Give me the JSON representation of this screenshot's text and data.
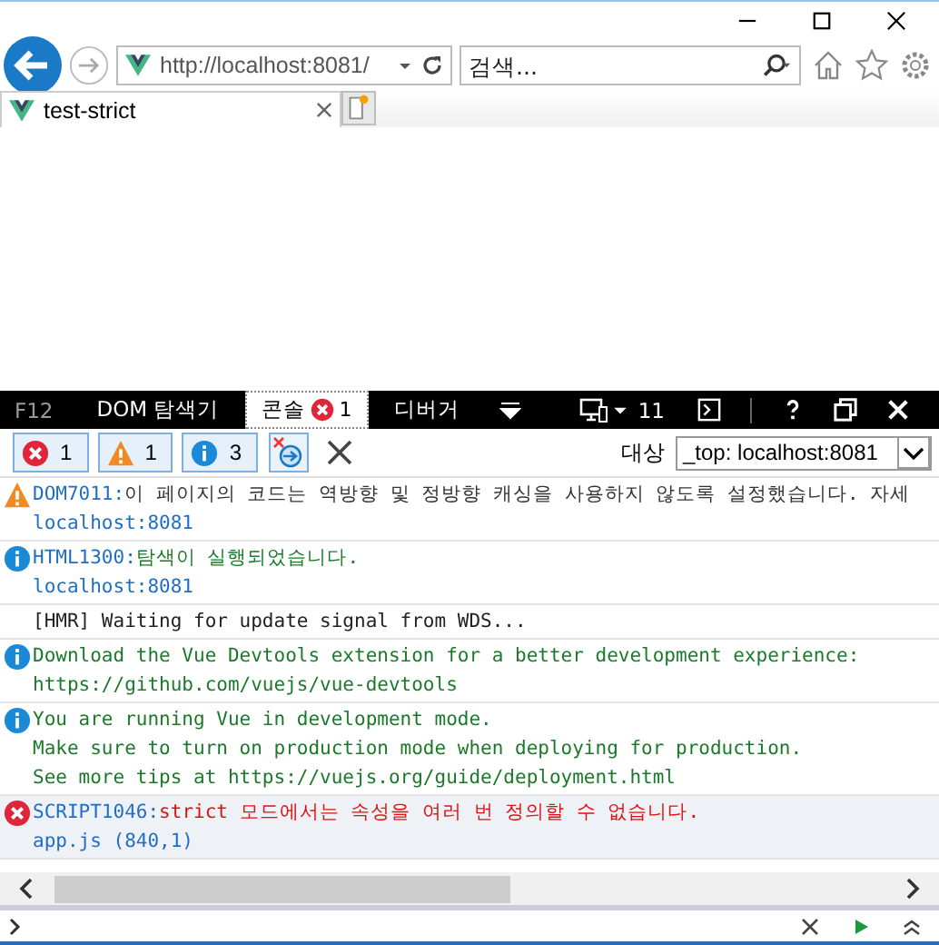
{
  "browser": {
    "address": "http://localhost:8081/",
    "search": {
      "placeholder": "검색..."
    },
    "tabs": [
      {
        "label": "test-strict",
        "selected": true
      }
    ]
  },
  "devtools": {
    "label": "F12",
    "tabs": [
      {
        "label": "DOM 탐색기",
        "selected": false
      },
      {
        "label": "콘솔",
        "selected": true,
        "errors": "1"
      },
      {
        "label": "디버거",
        "selected": false
      }
    ],
    "emulation": "11",
    "filters": [
      {
        "kind": "error",
        "count": "1",
        "on": true
      },
      {
        "kind": "warning",
        "count": "1",
        "on": true
      },
      {
        "kind": "info",
        "count": "3",
        "on": true
      }
    ],
    "target_label": "대상",
    "target": "_top: localhost:8081",
    "messages": [
      {
        "kind": "warning",
        "code": "DOM7011:",
        "lines": [
          "이 페이지의 코드는 역방향 및 정방향 캐싱을 사용하지 않도록 설정했습니다. 자세"
        ],
        "source": "localhost:8081"
      },
      {
        "kind": "info",
        "code": "HTML1300:",
        "lines": [
          "탐색이 실행되었습니다."
        ],
        "source": "localhost:8081"
      },
      {
        "kind": "log",
        "lines": [
          "[HMR] Waiting for update signal from WDS..."
        ]
      },
      {
        "kind": "info",
        "lines": [
          "Download the Vue Devtools extension for a better development experience:",
          "https://github.com/vuejs/vue-devtools"
        ]
      },
      {
        "kind": "info",
        "lines": [
          "You are running Vue in development mode.",
          "Make sure to turn on production mode when deploying for production.",
          "See more tips at https://vuejs.org/guide/deployment.html"
        ]
      },
      {
        "kind": "error",
        "code": "SCRIPT1046:",
        "lines": [
          "strict 모드에서는 속성을 여러 번 정의할 수 없습니다."
        ],
        "source": "app.js (840,1)"
      }
    ]
  }
}
